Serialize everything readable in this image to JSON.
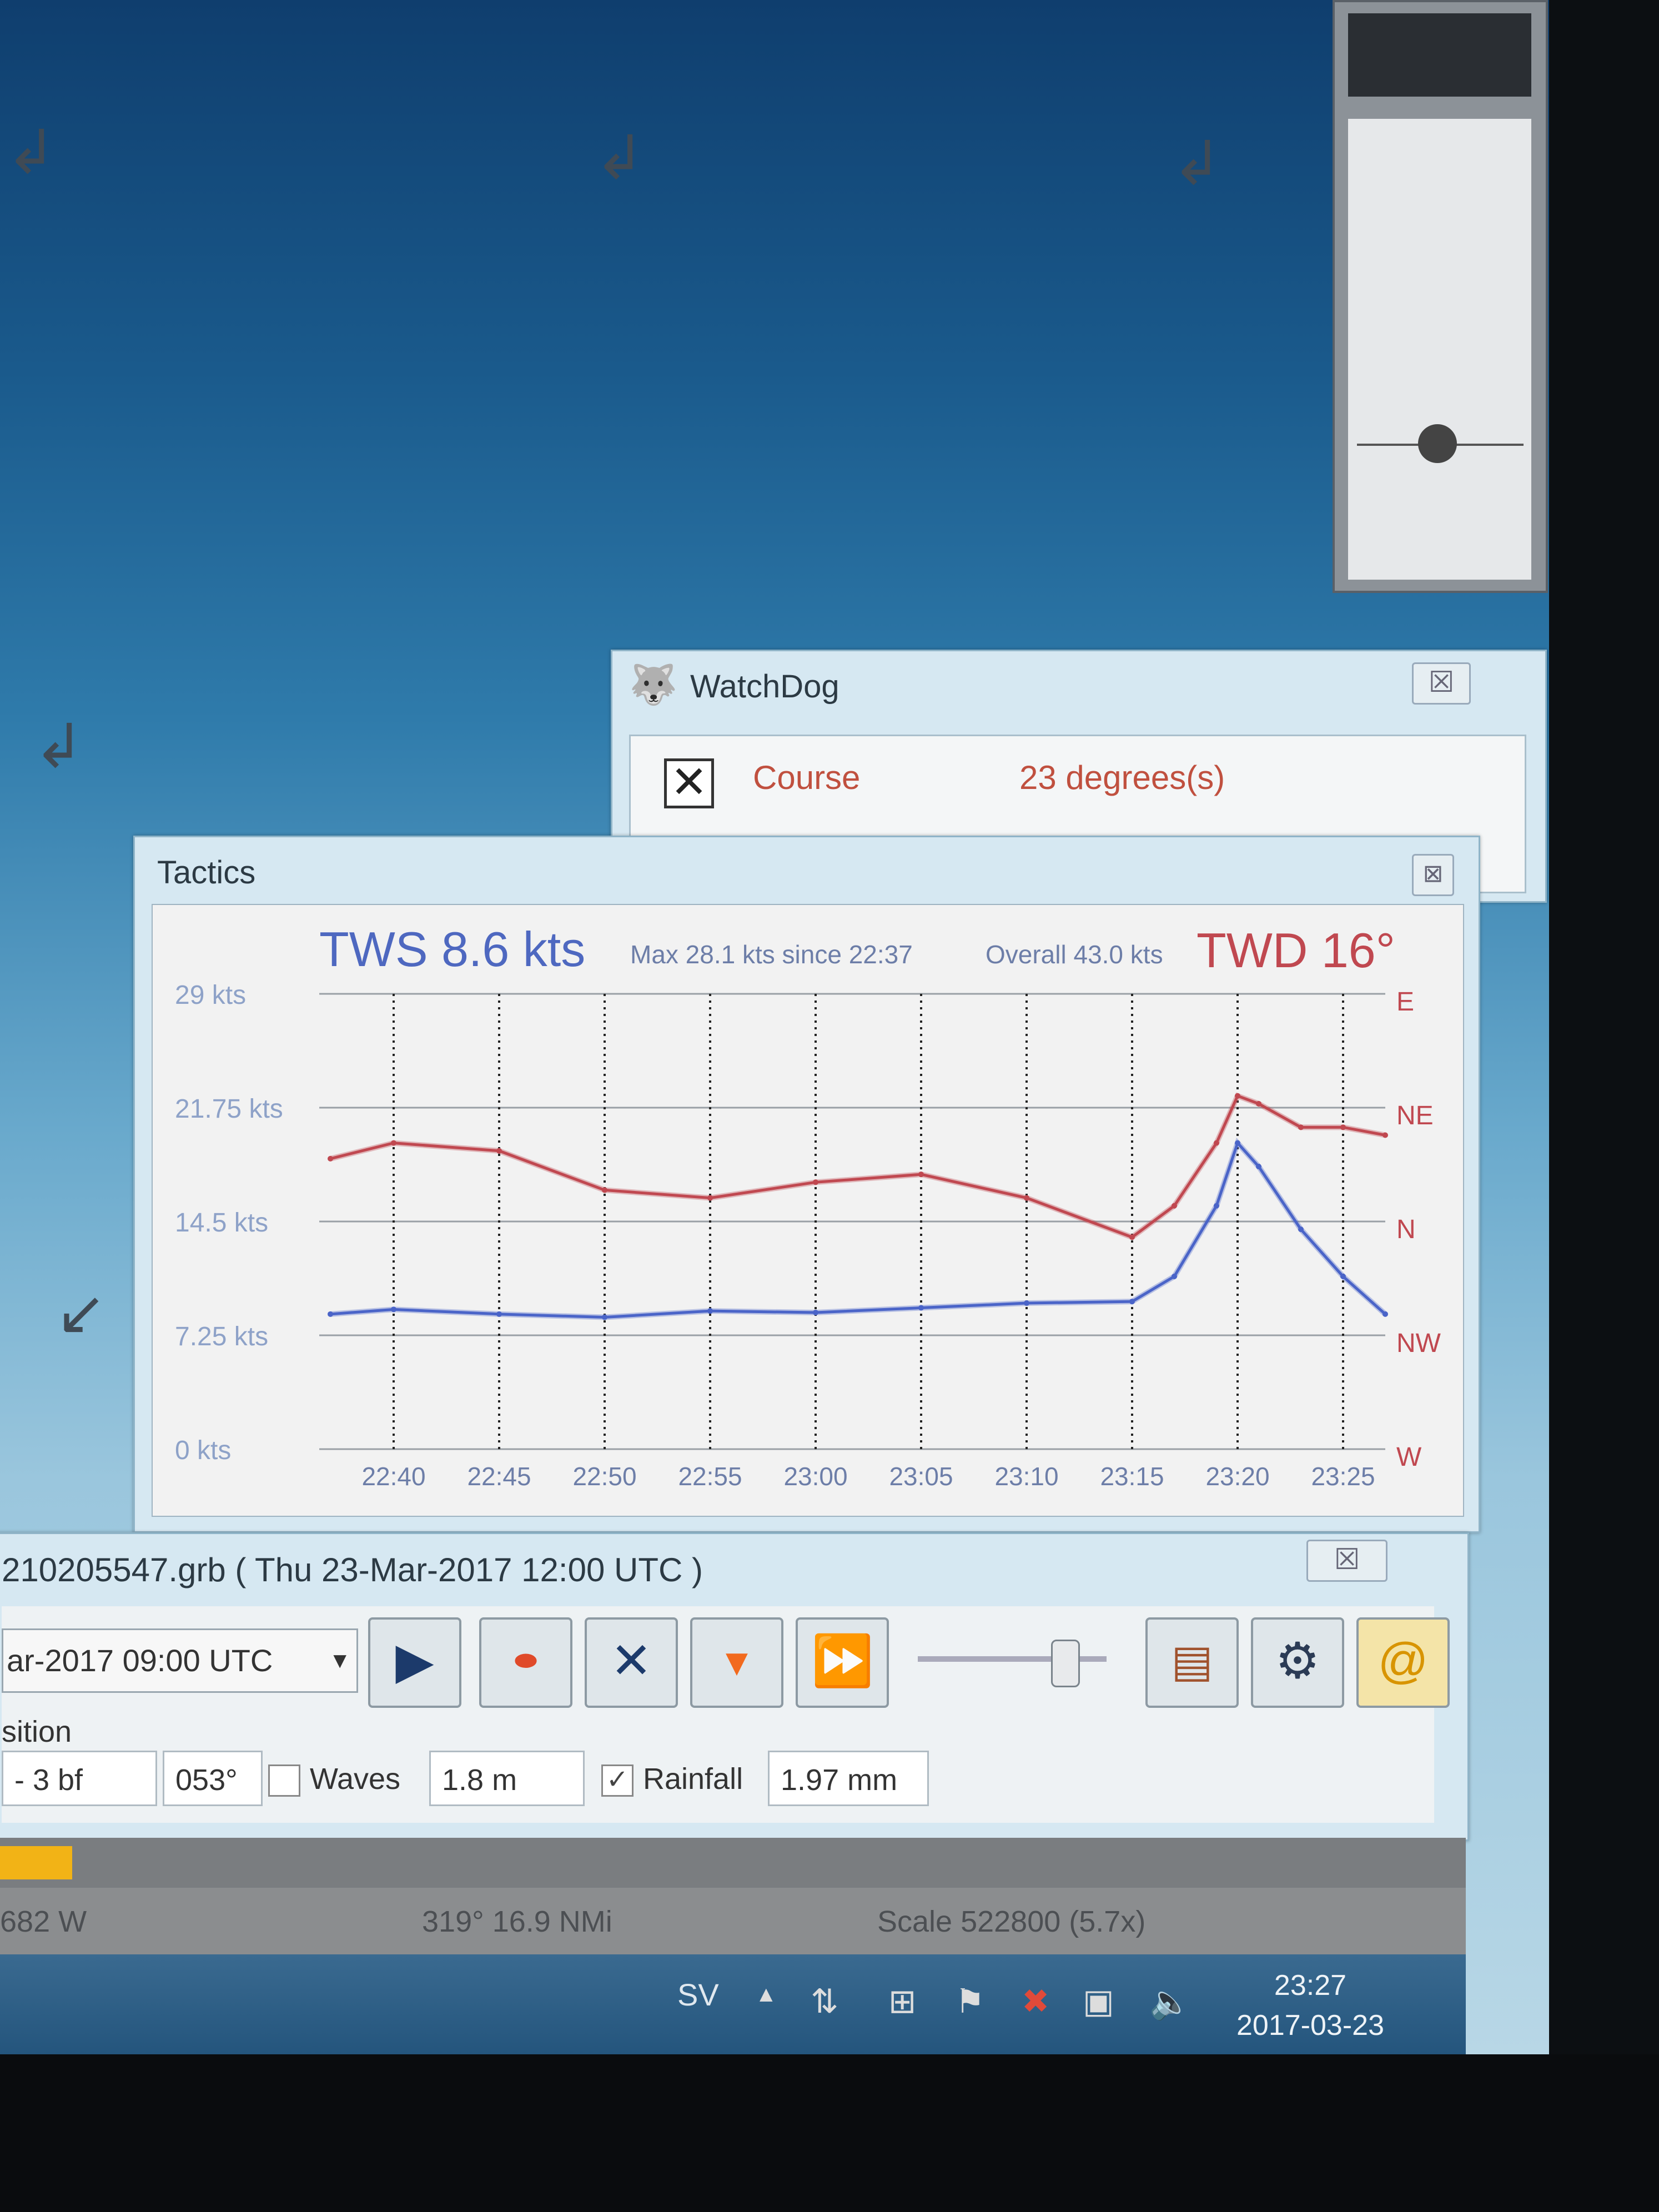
{
  "watchdog": {
    "title": "WatchDog",
    "close": "☒",
    "alarm": {
      "label": "Course",
      "value": "23 degrees(s)",
      "checked": true
    }
  },
  "tactics": {
    "title": "Tactics",
    "close": "⊠",
    "header": {
      "tws": "TWS 8.6 kts",
      "max": "Max 28.1 kts since 22:37",
      "overall": "Overall 43.0 kts",
      "twd": "TWD  16°"
    },
    "y_ticks": [
      "29 kts",
      "21.75 kts",
      "14.5 kts",
      "7.25 kts",
      "0 kts"
    ],
    "dir_ticks": [
      "E",
      "NE",
      "N",
      "NW",
      "W"
    ],
    "x_ticks": [
      "22:40",
      "22:45",
      "22:50",
      "22:55",
      "23:00",
      "23:05",
      "23:10",
      "23:15",
      "23:20",
      "23:25"
    ]
  },
  "chart_data": {
    "type": "line",
    "title": "TWS 8.6 kts",
    "x": [
      "22:37",
      "22:40",
      "22:45",
      "22:50",
      "22:55",
      "23:00",
      "23:05",
      "23:10",
      "23:15",
      "23:17",
      "23:19",
      "23:20",
      "23:21",
      "23:23",
      "23:25",
      "23:27"
    ],
    "ylim": [
      0,
      29
    ],
    "series": [
      {
        "name": "TWS",
        "color": "#4a64c8",
        "values": [
          8.6,
          8.9,
          8.6,
          8.4,
          8.8,
          8.7,
          9.0,
          9.3,
          9.4,
          11.0,
          15.5,
          19.5,
          18.0,
          14.0,
          11.0,
          8.6
        ]
      },
      {
        "name": "TWD",
        "color": "#c04850",
        "axis": "direction",
        "values": [
          18.5,
          19.5,
          19.0,
          16.5,
          16.0,
          17.0,
          17.5,
          16.0,
          13.5,
          15.5,
          19.5,
          22.5,
          22.0,
          20.5,
          20.5,
          20.0
        ]
      }
    ]
  },
  "grib": {
    "title": "210205547.grb ( Thu 23-Mar-2017 12:00  UTC )",
    "close": "☒",
    "date_select": "ar-2017 09:00  UTC",
    "position_label": "sition",
    "wind": "- 3 bf",
    "direction": "053°",
    "waves_label": "Waves",
    "waves_value": "1.8 m",
    "waves_checked": false,
    "rainfall_label": "Rainfall",
    "rainfall_value": "1.97 mm",
    "rainfall_checked": true,
    "buttons": [
      "play",
      "now",
      "zoom",
      "interval",
      "fast-forward",
      "settings",
      "email",
      "cursor-data"
    ]
  },
  "status": {
    "lon": "682 W",
    "bearing": "319°  16.9 NMi",
    "scale": "Scale 522800 (5.7x)"
  },
  "taskbar": {
    "lang": "SV",
    "time": "23:27",
    "date": "2017-03-23"
  },
  "colors": {
    "tws": "#4a64c8",
    "twd": "#c04850"
  }
}
